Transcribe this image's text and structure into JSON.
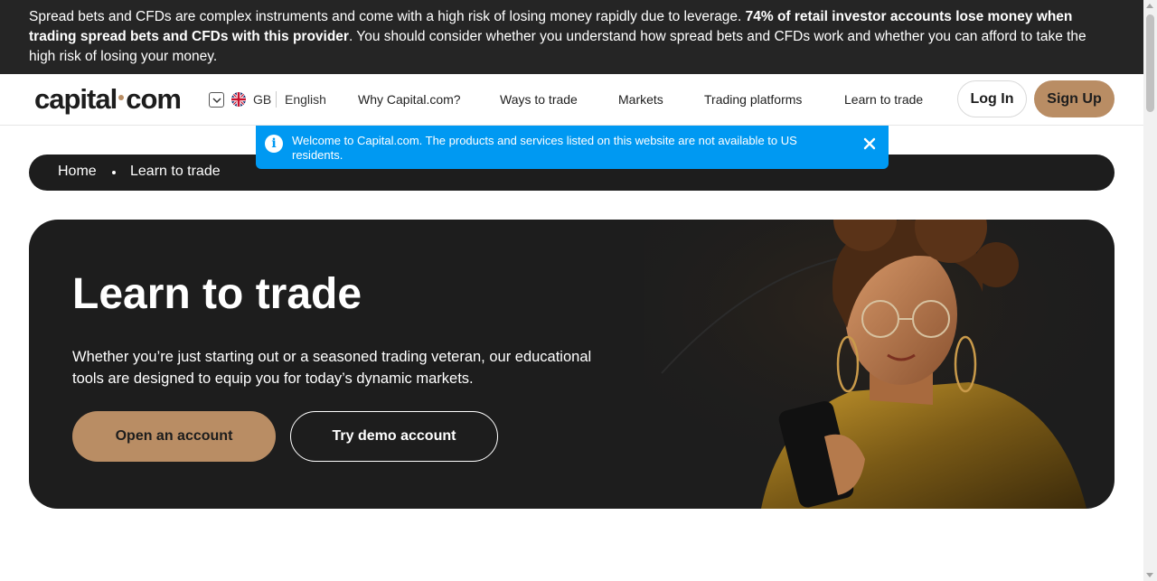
{
  "risk_warning": {
    "text_start": "Spread bets and CFDs are complex instruments and come with a high risk of losing money rapidly due to leverage. ",
    "text_bold": "74% of retail investor accounts lose money when trading spread bets and CFDs with this provider",
    "text_end": ". You should consider whether you understand how spread bets and CFDs work and whether you can afford to take the high risk of losing your money."
  },
  "header": {
    "logo_left": "capital",
    "logo_right": "com",
    "language": {
      "country": "GB",
      "name": "English",
      "flag_icon": "uk-flag-icon"
    },
    "nav": [
      "Why Capital.com?",
      "Ways to trade",
      "Markets",
      "Trading platforms",
      "Learn to trade"
    ],
    "login_label": "Log In",
    "signup_label": "Sign Up"
  },
  "notice": {
    "text": "Welcome to Capital.com. The products and services listed on this website are not available to US residents.",
    "color": "#0099f2"
  },
  "breadcrumb": {
    "home": "Home",
    "current": "Learn to trade"
  },
  "hero": {
    "title": "Learn to trade",
    "description": "Whether you’re just starting out or a seasoned trading veteran, our educational tools are designed to equip you for today’s dynamic markets.",
    "open_account_label": "Open an account",
    "demo_account_label": "Try demo account"
  },
  "colors": {
    "accent": "#b98d64",
    "dark": "#1d1d1d",
    "banner": "#252525"
  }
}
